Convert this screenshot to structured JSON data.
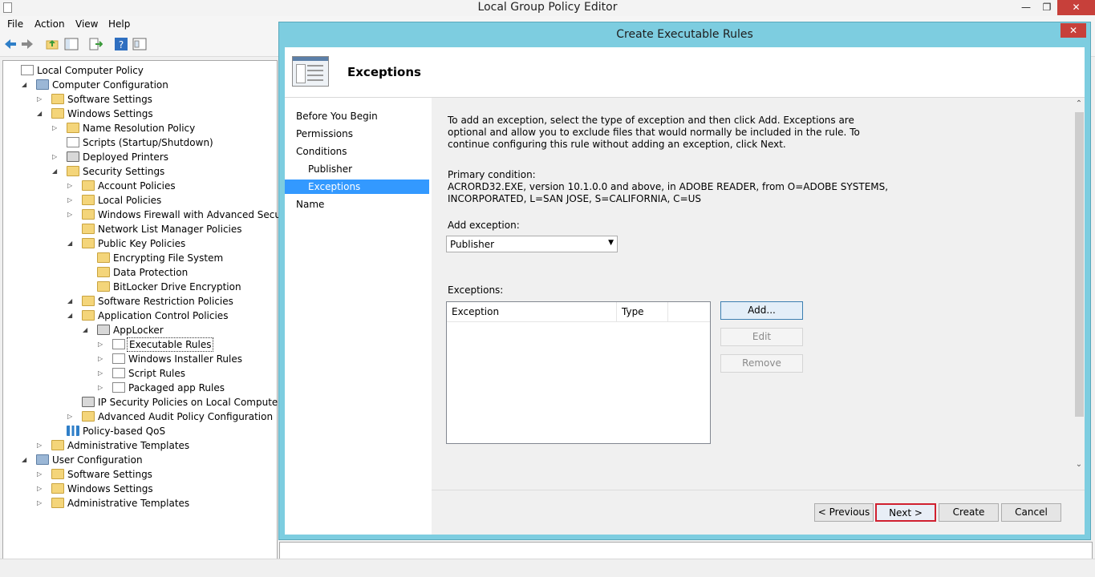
{
  "window": {
    "title": "Local Group Policy Editor",
    "minimize": "—",
    "maximize": "❐",
    "close": "✕"
  },
  "menu": [
    "File",
    "Action",
    "View",
    "Help"
  ],
  "tree": [
    {
      "label": "Local Computer Policy",
      "expander": ""
    },
    {
      "label": "Computer Configuration",
      "expander": "◢"
    },
    {
      "label": "Software Settings",
      "expander": "▷"
    },
    {
      "label": "Windows Settings",
      "expander": "◢"
    },
    {
      "label": "Name Resolution Policy",
      "expander": "▷"
    },
    {
      "label": "Scripts (Startup/Shutdown)",
      "expander": ""
    },
    {
      "label": "Deployed Printers",
      "expander": "▷"
    },
    {
      "label": "Security Settings",
      "expander": "◢"
    },
    {
      "label": "Account Policies",
      "expander": "▷"
    },
    {
      "label": "Local Policies",
      "expander": "▷"
    },
    {
      "label": "Windows Firewall with Advanced Security",
      "expander": "▷"
    },
    {
      "label": "Network List Manager Policies",
      "expander": ""
    },
    {
      "label": "Public Key Policies",
      "expander": "◢"
    },
    {
      "label": "Encrypting File System",
      "expander": ""
    },
    {
      "label": "Data Protection",
      "expander": ""
    },
    {
      "label": "BitLocker Drive Encryption",
      "expander": ""
    },
    {
      "label": "Software Restriction Policies",
      "expander": "◢"
    },
    {
      "label": "Application Control Policies",
      "expander": "◢"
    },
    {
      "label": "AppLocker",
      "expander": "◢"
    },
    {
      "label": "Executable Rules",
      "expander": "▷"
    },
    {
      "label": "Windows Installer Rules",
      "expander": "▷"
    },
    {
      "label": "Script Rules",
      "expander": "▷"
    },
    {
      "label": "Packaged app Rules",
      "expander": "▷"
    },
    {
      "label": "IP Security Policies on Local Computer",
      "expander": ""
    },
    {
      "label": "Advanced Audit Policy Configuration",
      "expander": "▷"
    },
    {
      "label": "Policy-based QoS",
      "expander": ""
    },
    {
      "label": "Administrative Templates",
      "expander": "▷"
    },
    {
      "label": "User Configuration",
      "expander": "◢"
    },
    {
      "label": "Software Settings",
      "expander": "▷"
    },
    {
      "label": "Windows Settings",
      "expander": "▷"
    },
    {
      "label": "Administrative Templates",
      "expander": "▷"
    }
  ],
  "dialog": {
    "title": "Create Executable Rules",
    "close": "✕",
    "header": "Exceptions",
    "steps": [
      "Before You Begin",
      "Permissions",
      "Conditions",
      "Publisher",
      "Exceptions",
      "Name"
    ],
    "active_step": "Exceptions",
    "intro_lines": [
      "To add an exception, select the type of exception and then click Add. Exceptions are",
      "optional and allow you to exclude files that would normally be included in the rule. To",
      "continue configuring this rule without adding an exception, click Next."
    ],
    "primary_label": "Primary condition:",
    "primary_lines": [
      "ACRORD32.EXE, version 10.1.0.0 and above, in ADOBE READER, from O=ADOBE SYSTEMS,",
      "INCORPORATED, L=SAN JOSE, S=CALIFORNIA, C=US"
    ],
    "add_exception_label": "Add exception:",
    "add_exception_value": "Publisher",
    "exceptions_label": "Exceptions:",
    "table_headers": [
      "Exception",
      "Type"
    ],
    "buttons": {
      "add": "Add...",
      "edit": "Edit",
      "remove": "Remove",
      "previous": "< Previous",
      "next": "Next >",
      "create": "Create",
      "cancel": "Cancel"
    }
  },
  "colors": {
    "dialog_frame": "#7dcde0",
    "active_step": "#3399ff",
    "next_highlight": "#d0202f",
    "close_button": "#c7403a"
  }
}
